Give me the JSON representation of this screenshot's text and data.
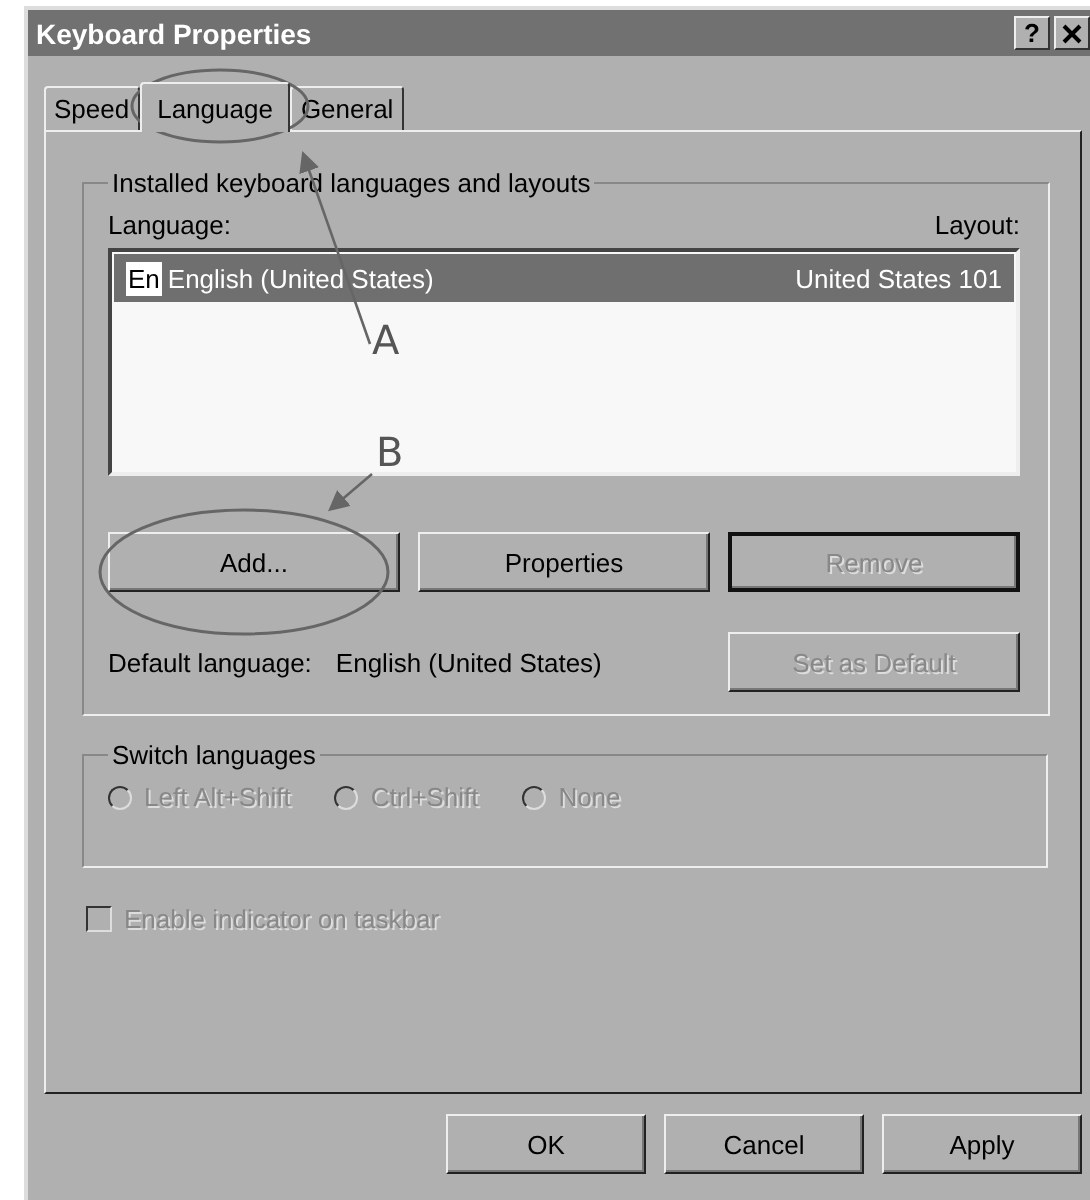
{
  "window": {
    "title": "Keyboard Properties",
    "help_button": "?"
  },
  "tabs": [
    {
      "label": "Speed",
      "selected": false
    },
    {
      "label": "Language",
      "selected": true
    },
    {
      "label": "General",
      "selected": false
    }
  ],
  "installed_group": {
    "title": "Installed keyboard languages and layouts",
    "language_header": "Language:",
    "layout_header": "Layout:",
    "rows": [
      {
        "badge": "En",
        "language": "English (United States)",
        "layout": "United States 101",
        "selected": true
      }
    ],
    "buttons": [
      {
        "label": "Add...",
        "disabled": false
      },
      {
        "label": "Properties",
        "disabled": false
      },
      {
        "label": "Remove",
        "disabled": true
      }
    ],
    "default_language_label": "Default language:",
    "default_language_value": "English (United States)",
    "set_default_button": {
      "label": "Set as Default",
      "disabled": true
    }
  },
  "switch_group": {
    "title": "Switch languages",
    "options": [
      {
        "label": "Left Alt+Shift",
        "checked": false,
        "disabled": true
      },
      {
        "label": "Ctrl+Shift",
        "checked": false,
        "disabled": true
      },
      {
        "label": "None",
        "checked": false,
        "disabled": true
      }
    ]
  },
  "indicator_checkbox": {
    "label": "Enable indicator on taskbar",
    "checked": false,
    "disabled": true
  },
  "footer_buttons": [
    "OK",
    "Cancel",
    "Apply"
  ],
  "annotations": [
    {
      "label": "A"
    },
    {
      "label": "B"
    }
  ]
}
